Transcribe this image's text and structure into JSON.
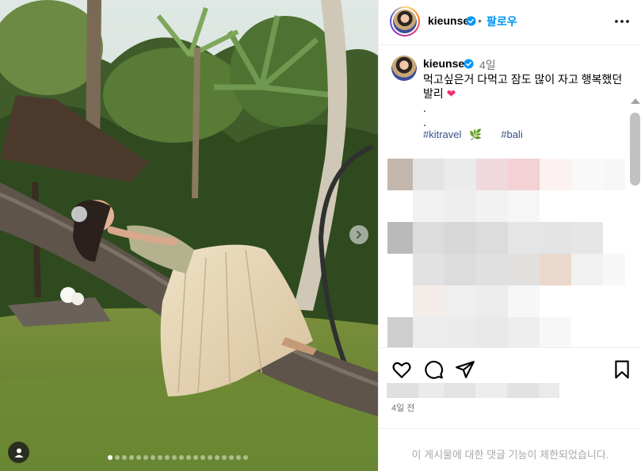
{
  "post": {
    "username": "kieunse",
    "follow_label": "팔로우",
    "separator": "•",
    "more_icon": "more-horizontal-icon",
    "verified_icon": "verified-badge-icon"
  },
  "caption": {
    "username": "kieunse",
    "time": "4일",
    "text": "먹고싶은거 다먹고 잠도 많이 자고 행복했던 발리",
    "heart": "❤",
    "dot1": ".",
    "dot2": ".",
    "hashtag1": "#kitravel",
    "hashtag1_emoji": "🌿",
    "hashtag2": "#bali"
  },
  "actions": {
    "like_icon": "heart-icon",
    "comment_icon": "comment-icon",
    "share_icon": "share-icon",
    "save_icon": "bookmark-icon"
  },
  "post_time": "4일 전",
  "comments_limited": "이 게시물에 대한 댓글 기능이 제한되었습니다.",
  "colors": {
    "link": "#0095f6",
    "hashtag": "#385185",
    "muted": "#737373",
    "heart": "#f0316f"
  }
}
